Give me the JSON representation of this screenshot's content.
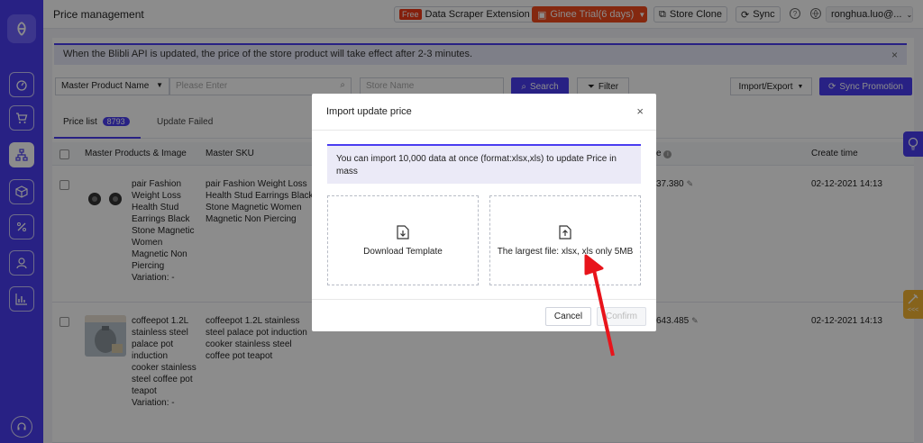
{
  "header": {
    "page_title": "Price management",
    "free_badge": "Free",
    "data_scraper": "Data Scraper Extension",
    "trial": "Ginee Trial(6 days)",
    "store_clone": "Store Clone",
    "sync": "Sync",
    "help_icon": "?",
    "user": "ronghua.luo@..."
  },
  "notice": {
    "text": "When the Blibli API is updated, the price of the store product will take effect after 2-3 minutes.",
    "close": "×"
  },
  "filters": {
    "master_select": "Master Product Name",
    "search_placeholder": "Please Enter",
    "store_placeholder": "Store Name",
    "search_btn": "Search",
    "filter_btn": "Filter",
    "import_export": "Import/Export",
    "sync_promotion": "Sync Promotion"
  },
  "tabs": {
    "price_list": "Price list",
    "price_list_count": "8793",
    "update_failed": "Update Failed"
  },
  "table": {
    "headers": {
      "products": "Master Products & Image",
      "sku": "Master SKU",
      "price_suffix": "e",
      "created": "Create time"
    },
    "rows": [
      {
        "name": "pair Fashion Weight Loss Health Stud Earrings Black Stone Magnetic Women Magnetic Non Piercing",
        "variation": "Variation: -",
        "sku": "pair Fashion Weight Loss Health Stud Earrings Black Stone Magnetic Women Magnetic Non Piercing",
        "price": "37.380",
        "created": "02-12-2021 14:13"
      },
      {
        "name": "coffeepot 1.2L stainless steel palace pot induction cooker stainless steel coffee pot teapot",
        "variation": "Variation: -",
        "sku": "coffeepot 1.2L stainless steel palace pot induction cooker stainless steel coffee pot teapot",
        "price": "643.485",
        "created": "02-12-2021 14:13"
      }
    ]
  },
  "modal": {
    "title": "Import update price",
    "close": "×",
    "info": "You can import 10,000 data at once (format:xlsx,xls) to update Price in mass",
    "download_template": "Download Template",
    "upload_hint": "The largest file: xlsx, xls only 5MB",
    "cancel": "Cancel",
    "confirm": "Confirm"
  },
  "float": {
    "collapse": "<<<"
  },
  "colors": {
    "primary": "#4a3df0",
    "trial": "#f04a1d",
    "arrow": "#e8141b"
  }
}
